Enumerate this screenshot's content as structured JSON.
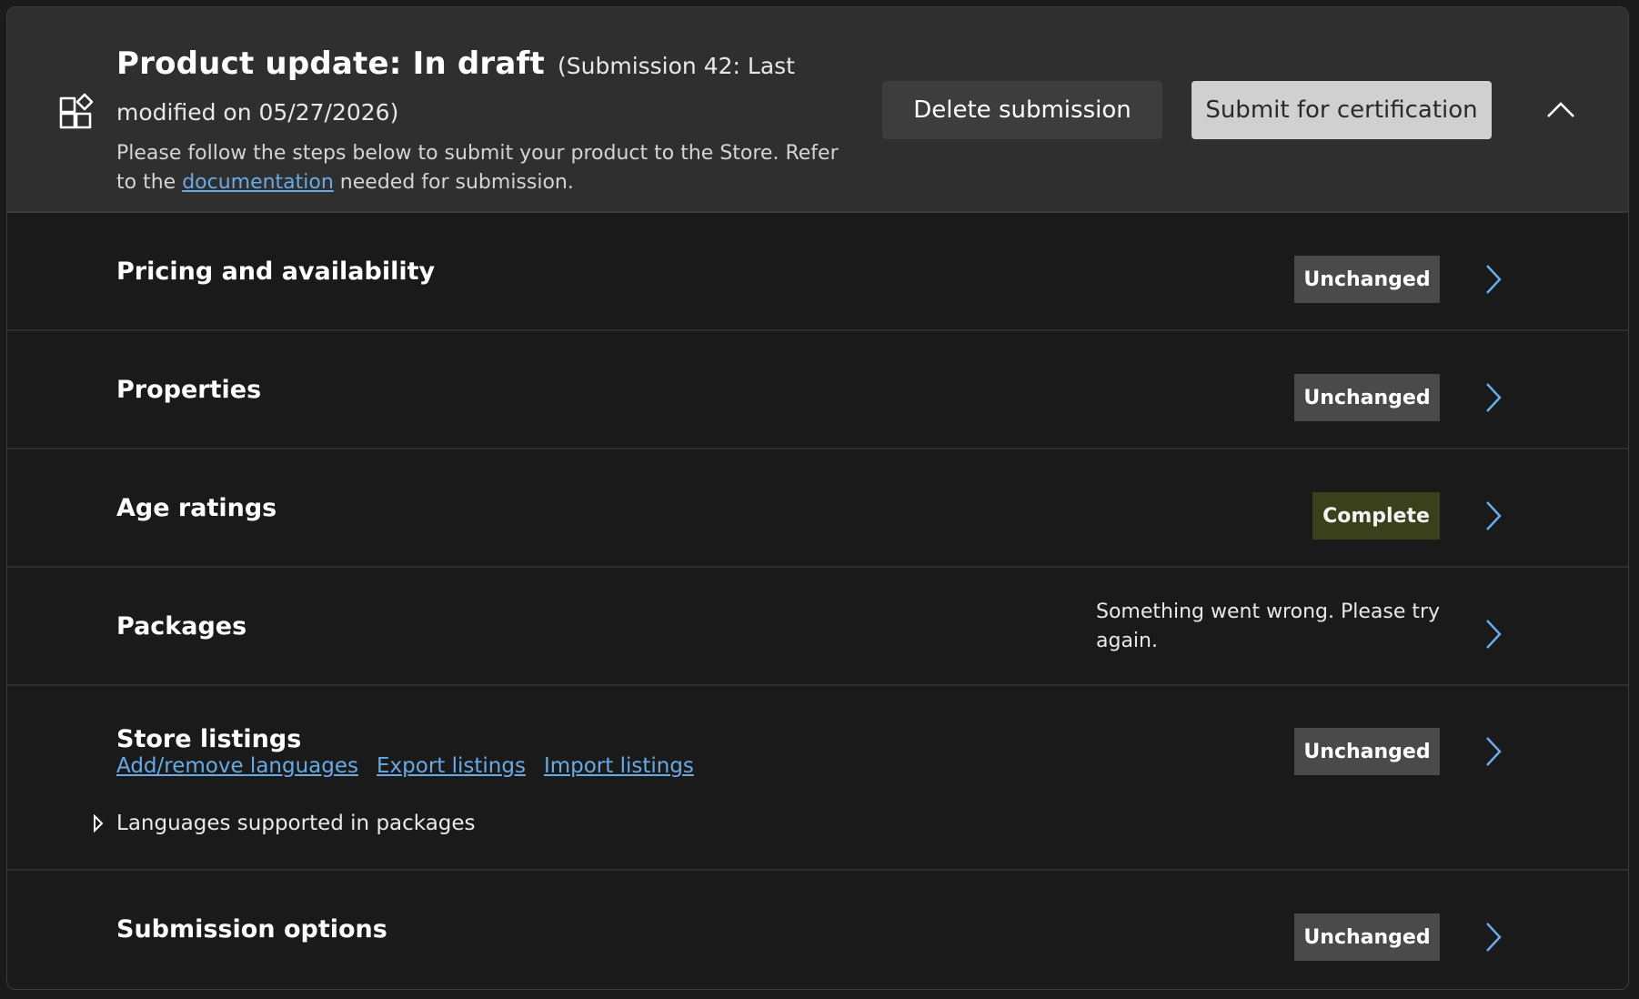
{
  "header": {
    "title": "Product update: In draft",
    "submission_info": "(Submission 42: Last modified on 05/27/2026)",
    "description_before_link": "Please follow the steps below to submit your product to the Store. Refer to the ",
    "description_link": "documentation",
    "description_after_link": " needed for submission.",
    "delete_button": "Delete submission",
    "submit_button": "Submit for certification",
    "icon": "store-app-icon",
    "collapse_icon": "chevron-up-icon"
  },
  "rows": {
    "pricing": {
      "title": "Pricing and availability",
      "status": "Unchanged"
    },
    "properties": {
      "title": "Properties",
      "status": "Unchanged"
    },
    "age_ratings": {
      "title": "Age ratings",
      "status": "Complete"
    },
    "packages": {
      "title": "Packages",
      "status_message": "Something went wrong. Please try again."
    },
    "store_listings": {
      "title": "Store listings",
      "status": "Unchanged",
      "links": [
        "Add/remove languages",
        "Export listings",
        "Import listings"
      ],
      "expander_label": "Languages supported in packages"
    },
    "submission_options": {
      "title": "Submission options",
      "status": "Unchanged"
    }
  },
  "colors": {
    "background": "#1a1a1a",
    "header_background": "#2f2f2f",
    "badge_unchanged": "#4a4a4a",
    "badge_complete": "#3a3f1c",
    "link": "#69a9e6",
    "chevron": "#6aaef0"
  }
}
